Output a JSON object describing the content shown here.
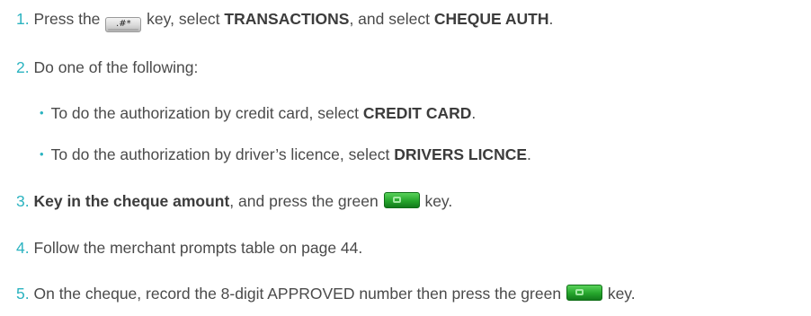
{
  "keys": {
    "hash_key_label": ".#*",
    "green_key_color": "#25a52c"
  },
  "steps": [
    {
      "num": "1.",
      "t1": "Press the",
      "t2": "key, select",
      "b1": "TRANSACTIONS",
      "t3": ", and select",
      "b2": "CHEQUE AUTH",
      "t4": "."
    },
    {
      "num": "2.",
      "t1": "Do one of the following:"
    },
    {
      "num": "3.",
      "b1": "Key in the cheque amount",
      "t1": ", and press the green",
      "t2": "key."
    },
    {
      "num": "4.",
      "t1": "Follow the merchant prompts table on page 44."
    },
    {
      "num": "5.",
      "t1": "On the cheque, record the 8-digit APPROVED number then press the green",
      "t2": "key."
    }
  ],
  "bullets": [
    {
      "glyph": "•",
      "t1": "To do the authorization by credit card, select",
      "b1": "CREDIT CARD",
      "t2": "."
    },
    {
      "glyph": "•",
      "t1": "To do the authorization by driver’s licence, select",
      "b1": "DRIVERS LICNCE",
      "t2": "."
    }
  ]
}
